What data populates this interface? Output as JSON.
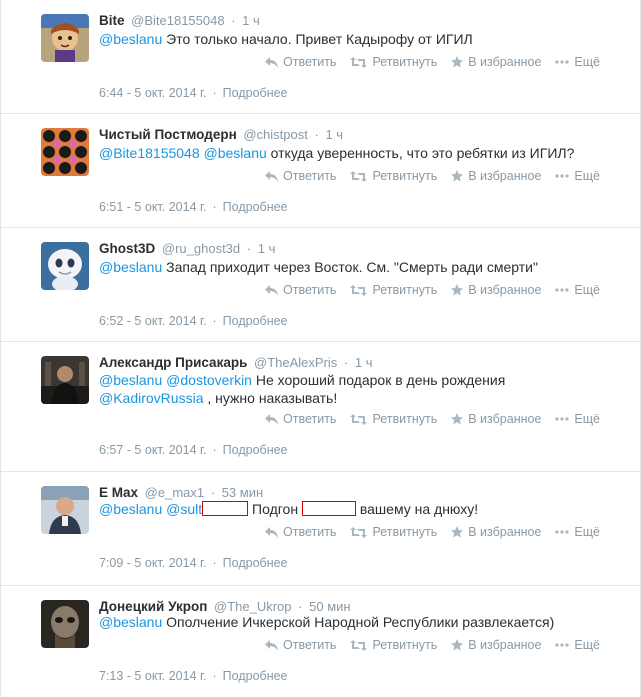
{
  "actions": {
    "reply": "Ответить",
    "retweet": "Ретвитнуть",
    "favorite": "В избранное",
    "more": "Ещё",
    "details": "Подробнее"
  },
  "tweets": [
    {
      "name": "Bite",
      "handle": "@Bite18155048",
      "time": "1 ч",
      "mentions": [
        "@beslanu"
      ],
      "text": " Это только начало. Привет Кадырофу от ИГИЛ",
      "date": "6:44 - 5 окт. 2014 г."
    },
    {
      "name": "Чистый Постмодерн",
      "handle": "@chistpost",
      "time": "1 ч",
      "mentions": [
        "@Bite18155048",
        "@beslanu"
      ],
      "text": " откуда уверенность, что это ребятки из ИГИЛ?",
      "date": "6:51 - 5 окт. 2014 г."
    },
    {
      "name": "Ghost3D",
      "handle": "@ru_ghost3d",
      "time": "1 ч",
      "mentions": [
        "@beslanu"
      ],
      "text": " Запад приходит через Восток. См. \"Смерть ради смерти\"",
      "date": "6:52 - 5 окт. 2014 г."
    },
    {
      "name": "Александр Присакарь",
      "handle": "@TheAlexPris",
      "time": "1 ч",
      "mentions": [
        "@beslanu",
        "@dostoverkin"
      ],
      "text": " Не хороший подарок в день рождения",
      "mention2": "@KadirovRussia",
      "text2": " , нужно наказывать!",
      "date": "6:57 - 5 окт. 2014 г."
    },
    {
      "name": "E Max",
      "handle": "@e_max1",
      "time": "53 мин",
      "mentions": [
        "@beslanu",
        "@sult"
      ],
      "text_a": " Подгон ",
      "text_b": " вашему на днюху!",
      "date": "7:09 - 5 окт. 2014 г."
    },
    {
      "name": "Донецкий Укроп",
      "handle": "@The_Ukrop",
      "time": "50 мин",
      "mentions": [
        "@beslanu"
      ],
      "text": " Ополчение Ичкерской Народной Республики развлекается)",
      "date": "7:13 - 5 окт. 2014 г."
    }
  ],
  "colors": {
    "link": "#1b95e0",
    "muted": "#8899a6",
    "redact": "#d80000"
  }
}
